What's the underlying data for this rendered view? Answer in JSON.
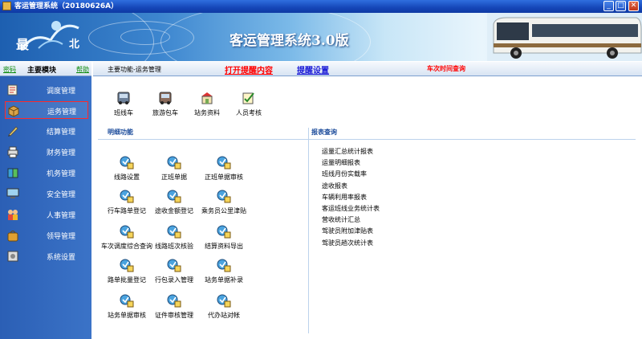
{
  "window": {
    "title": "客运管理系统（20180626A）",
    "controls": [
      "_",
      "□",
      "✕"
    ]
  },
  "banner": {
    "title": "客运管理系统3.0版",
    "logo_chars": [
      "最",
      "北"
    ]
  },
  "left": {
    "password_link": "密码",
    "header": "主要模块",
    "help_link": "帮助",
    "items": [
      {
        "label": "调度管理",
        "icon": "dispatch-icon"
      },
      {
        "label": "运务管理",
        "icon": "box-icon",
        "selected": true
      },
      {
        "label": "结算管理",
        "icon": "pen-icon"
      },
      {
        "label": "财务管理",
        "icon": "printer-icon"
      },
      {
        "label": "机务管理",
        "icon": "book-icon"
      },
      {
        "label": "安全管理",
        "icon": "monitor-icon"
      },
      {
        "label": "人事管理",
        "icon": "people-icon"
      },
      {
        "label": "领导管理",
        "icon": "bag-icon"
      },
      {
        "label": "系统设置",
        "icon": "gear-icon"
      }
    ]
  },
  "main": {
    "breadcrumb": "主要功能-运务管理",
    "alert_link": "打开提醒内容",
    "reminder_link": "提醒设置",
    "schedule_query": "车次时间查询",
    "toolbar": [
      {
        "label": "班线车",
        "icon": "bus-icon"
      },
      {
        "label": "旅游包车",
        "icon": "coach-icon"
      },
      {
        "label": "站务资料",
        "icon": "station-icon"
      },
      {
        "label": "人员考核",
        "icon": "check-icon"
      }
    ],
    "detail_header": "明细功能",
    "report_header": "报表查询",
    "functions": [
      "线路设置",
      "正班单据",
      "正班单据审核",
      "行车路单登记",
      "途收金额登记",
      "乘务员公里津贴",
      "车次调度综合查询",
      "线路班次核验",
      "结算资料导出",
      "路单批量登记",
      "行包录入管理",
      "站务单据补录",
      "站务单据审核",
      "证件审核管理",
      "代办站对帐"
    ],
    "reports": [
      "运量汇总统计报表",
      "运量明细报表",
      "班线月份实载率",
      "途收报表",
      "车辆利用率报表",
      "客运班线业务统计表",
      "营收统计汇总",
      "驾驶员附加津贴表",
      "驾驶员趟次统计表"
    ]
  },
  "colors": {
    "titlebar": "#1546b8",
    "leftpanel": "#3b73c7",
    "alert_red": "#ff0000",
    "link_blue": "#1a1ad6",
    "section_blue": "#1a4a9a"
  }
}
